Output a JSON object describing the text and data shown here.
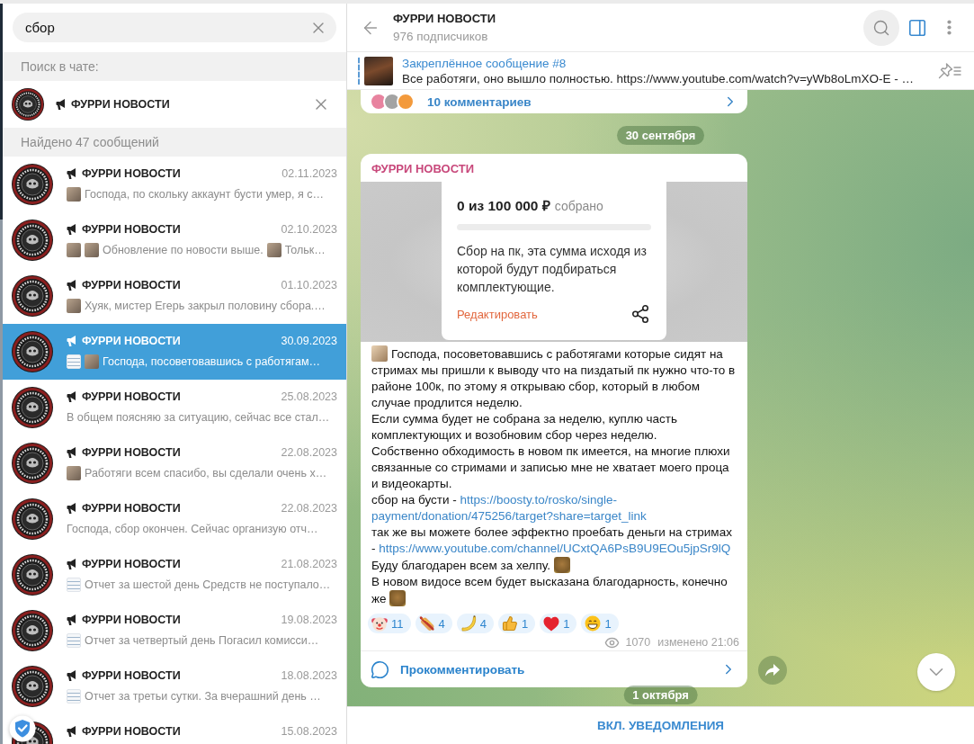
{
  "search": {
    "value": "сбор"
  },
  "chat_filter": {
    "label": "Поиск в чате:",
    "chat_name": "ФУРРИ НОВОСТИ"
  },
  "results_header": "Найдено 47 сообщений",
  "results": [
    {
      "name": "ФУРРИ НОВОСТИ",
      "date": "02.11.2023",
      "selected": false,
      "preview": [
        {
          "kind": "photo"
        },
        {
          "kind": "text",
          "text": "Господа, по скольку аккаунт бусти умер, я с…"
        }
      ]
    },
    {
      "name": "ФУРРИ НОВОСТИ",
      "date": "02.10.2023",
      "selected": false,
      "preview": [
        {
          "kind": "photo"
        },
        {
          "kind": "photo"
        },
        {
          "kind": "text",
          "text": "Обновление по новости выше."
        },
        {
          "kind": "photo"
        },
        {
          "kind": "text",
          "text": "Тольк…"
        }
      ]
    },
    {
      "name": "ФУРРИ НОВОСТИ",
      "date": "01.10.2023",
      "selected": false,
      "preview": [
        {
          "kind": "photo"
        },
        {
          "kind": "text",
          "text": "Хуяк, мистер Егерь закрыл половину сбора.…"
        }
      ]
    },
    {
      "name": "ФУРРИ НОВОСТИ",
      "date": "30.09.2023",
      "selected": true,
      "preview": [
        {
          "kind": "document"
        },
        {
          "kind": "photo"
        },
        {
          "kind": "text",
          "text": "Господа, посоветовавшись с работягам…"
        }
      ]
    },
    {
      "name": "ФУРРИ НОВОСТИ",
      "date": "25.08.2023",
      "selected": false,
      "preview": [
        {
          "kind": "text",
          "text": "В общем поясняю за ситуацию, сейчас все стал…"
        }
      ]
    },
    {
      "name": "ФУРРИ НОВОСТИ",
      "date": "22.08.2023",
      "selected": false,
      "preview": [
        {
          "kind": "photo"
        },
        {
          "kind": "text",
          "text": "Работяги всем спасибо, вы сделали очень х…"
        }
      ]
    },
    {
      "name": "ФУРРИ НОВОСТИ",
      "date": "22.08.2023",
      "selected": false,
      "preview": [
        {
          "kind": "text",
          "text": "Господа, сбор окончен. Сейчас организую отч…"
        }
      ]
    },
    {
      "name": "ФУРРИ НОВОСТИ",
      "date": "21.08.2023",
      "selected": false,
      "preview": [
        {
          "kind": "document"
        },
        {
          "kind": "text",
          "text": "Отчет за шестой день Средств не поступало…"
        }
      ]
    },
    {
      "name": "ФУРРИ НОВОСТИ",
      "date": "19.08.2023",
      "selected": false,
      "preview": [
        {
          "kind": "document"
        },
        {
          "kind": "text",
          "text": "Отчет за четвертый день Погасил комисси…"
        }
      ]
    },
    {
      "name": "ФУРРИ НОВОСТИ",
      "date": "18.08.2023",
      "selected": false,
      "preview": [
        {
          "kind": "document"
        },
        {
          "kind": "text",
          "text": "Отчет за третьи сутки. За вчерашний день …"
        }
      ]
    },
    {
      "name": "ФУРРИ НОВОСТИ",
      "date": "15.08.2023",
      "selected": false
    }
  ],
  "chat": {
    "title": "ФУРРИ НОВОСТИ",
    "subtitle": "976 подписчиков",
    "search_highlighted": true,
    "side_panel_open": true
  },
  "pinned": {
    "title": "Закреплённое сообщение #8",
    "text": "Все работяги, оно вышло полностью. https://www.youtube.com/watch?v=yWb8oLmXO-E - …"
  },
  "previous_message": {
    "commenters": [
      {
        "color": "#e8839f"
      },
      {
        "color": "#a3a3a3"
      },
      {
        "color": "#f39a3c"
      }
    ],
    "comments": "10 комментариев"
  },
  "date_separator": "30 сентября",
  "message": {
    "author": "ФУРРИ НОВОСТИ",
    "fundraiser": {
      "amount": "0 из 100 000 ₽",
      "amount_caption": "собрано",
      "description": "Сбор на пк, эта сумма исходя из которой будут подбираться комплектующие.",
      "edit_link": "Редактировать"
    },
    "paragraphs": [
      {
        "parts": [
          {
            "kind": "photo"
          },
          {
            "kind": "text",
            "text": "Господа, посоветовавшись с работягами которые сидят на стримах мы пришли к выводу что на пиздатый пк нужно что-то в районе 100к, по этому я открываю сбор, который в любом случае продлится неделю."
          }
        ]
      },
      {
        "parts": [
          {
            "kind": "text",
            "text": "Если сумма будет не собрана за неделю, куплю часть комплектующих и возобновим сбор через неделю."
          }
        ]
      },
      {
        "parts": [
          {
            "kind": "text",
            "text": "Собственно обходимость в новом пк имеется, на многие плюхи связанные со стримами и записью мне не хватает моего проца и видеокарты."
          }
        ]
      },
      {
        "parts": [
          {
            "kind": "text",
            "text": "сбор на бусти - "
          },
          {
            "kind": "link",
            "text": "https://boosty.to/rosko/single-"
          },
          {
            "kind": "link",
            "text": "payment/donation/475256/target?share=target_link"
          }
        ]
      },
      {
        "parts": [
          {
            "kind": "text",
            "text": "так же вы можете более эффектно проебать деньги на стримах - "
          },
          {
            "kind": "link",
            "text": "https://www.youtube.com/channel/UCxtQA6PsB9U9EOu5jpSr9lQ"
          }
        ]
      },
      {
        "parts": [
          {
            "kind": "text",
            "text": "Буду благодарен всем за хелпу. "
          },
          {
            "kind": "sticker"
          }
        ]
      },
      {
        "parts": [
          {
            "kind": "text",
            "text": "В новом видосе всем будет высказана благодарность, конечно же "
          },
          {
            "kind": "sticker"
          }
        ]
      }
    ],
    "reactions": [
      {
        "kind": "clown",
        "count": "11"
      },
      {
        "kind": "hotdog",
        "count": "4"
      },
      {
        "kind": "banana",
        "count": "4"
      },
      {
        "kind": "thumbsup",
        "count": "1"
      },
      {
        "kind": "heart",
        "count": "1"
      },
      {
        "kind": "grin",
        "count": "1"
      }
    ],
    "views": "1070",
    "edited": "изменено 21:06",
    "comment_button": "Прокомментировать"
  },
  "next_date_separator": "1 октября",
  "bottom_bar": {
    "button": "ВКЛ. УВЕДОМЛЕНИЯ"
  }
}
